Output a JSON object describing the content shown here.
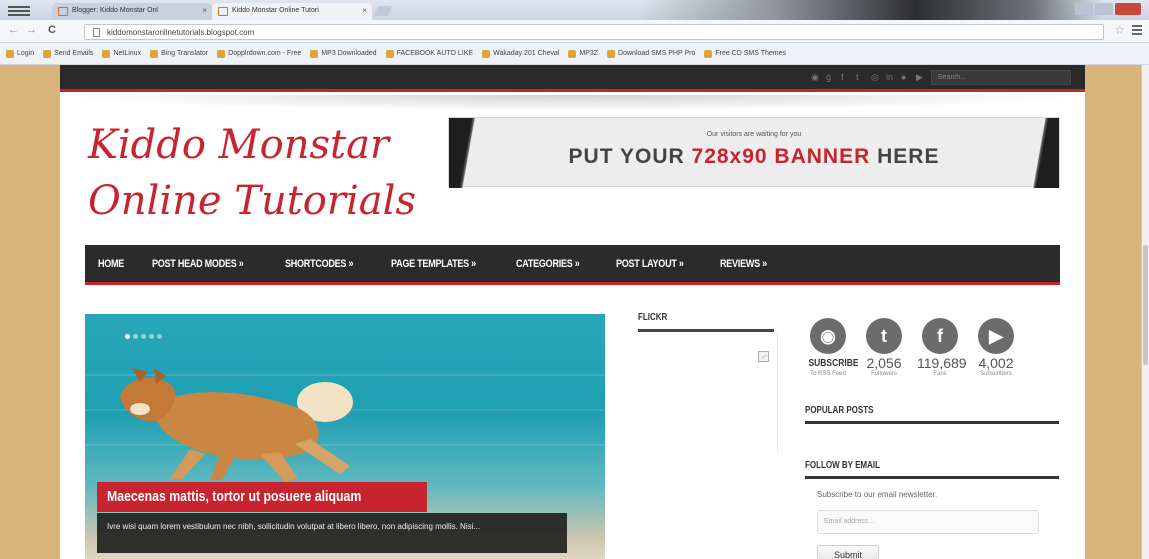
{
  "browser": {
    "tabs": [
      {
        "label": "Blogger: Kiddo Monstar Onl"
      },
      {
        "label": "Kiddo Monstar Online Tutori"
      }
    ],
    "url": "kiddomonstaronlinetutorials.blogspot.com",
    "bookmarks": [
      "Login",
      "Send Emails",
      "NetLinux",
      "Bing Translator",
      "Dopplrdown.com - Free",
      "MP3 Downloaded",
      "FACEBOOK AUTO LIKE",
      "Wakaday 201 Cheval",
      "MP3Z",
      "Download SMS PHP Pro",
      "Free CD SMS Themes"
    ]
  },
  "site": {
    "search_placeholder": "Search...",
    "social_top_icons": [
      "rss-icon",
      "google-plus-icon",
      "facebook-icon",
      "twitter-icon",
      "dribbble-icon",
      "linkedin-icon",
      "flickr-icon",
      "youtube-icon"
    ],
    "logo_line1": "Kiddo Monstar",
    "logo_line2": "Online Tutorials",
    "banner": {
      "small_text": "Our visitors are waiting for you",
      "big_prefix": "PUT YOUR ",
      "big_accent": "728x90",
      "big_mid": " BANNER",
      "big_suffix": " HERE"
    },
    "nav": [
      "HOME",
      "POST HEAD MODES »",
      "SHORTCODES »",
      "PAGE TEMPLATES »",
      "CATEGORIES »",
      "POST LAYOUT »",
      "REVIEWS »"
    ],
    "slider": {
      "title": "Maecenas mattis, tortor ut posuere aliquam",
      "text": "Ivre wisi quam lorem vestibulum nec nibh, sollicitudin volutpat at libero libero, non adipiscing mollis. Nisi..."
    },
    "flickr_title": "FLICKR",
    "social_counter": [
      {
        "icon": "rss-icon",
        "symbol": "◉",
        "count": "SUBSCRIBE",
        "label": "To RSS Feed",
        "color": "#6b6b6b"
      },
      {
        "icon": "twitter-icon",
        "symbol": "t",
        "count": "2,056",
        "label": "Followers",
        "color": "#6b6b6b"
      },
      {
        "icon": "facebook-icon",
        "symbol": "f",
        "count": "119,689",
        "label": "Fans",
        "color": "#6b6b6b"
      },
      {
        "icon": "youtube-icon",
        "symbol": "▶",
        "count": "4,002",
        "label": "Subscribers",
        "color": "#6b6b6b"
      }
    ],
    "popular_posts_title": "POPULAR POSTS",
    "follow_email_title": "FOLLOW BY EMAIL",
    "subscribe_text": "Subscribe to our email newsletter.",
    "email_placeholder": "Email address...",
    "submit_label": "Submit"
  },
  "colors": {
    "accent": "#c8242f",
    "dark": "#2b2b2b"
  }
}
